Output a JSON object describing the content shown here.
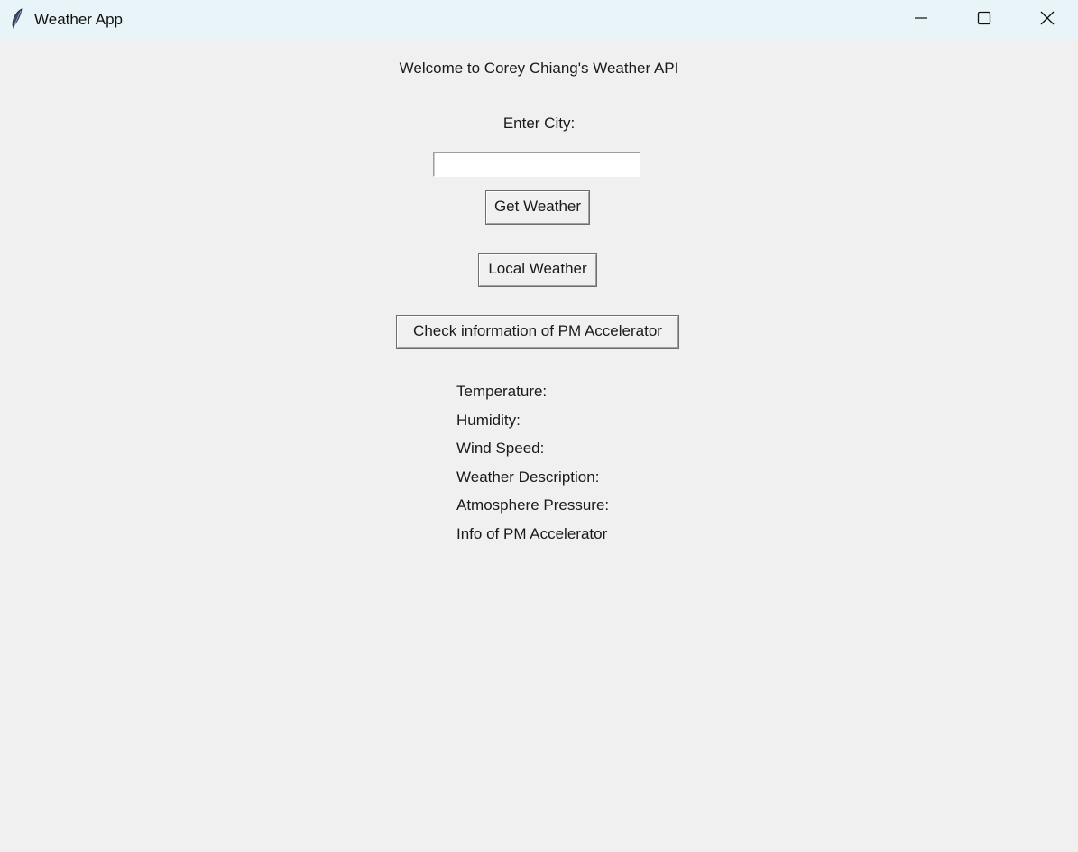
{
  "window": {
    "title": "Weather App",
    "icon": "feather-icon",
    "controls": {
      "minimize_icon": "minimize-icon",
      "maximize_icon": "maximize-icon",
      "close_icon": "close-icon"
    }
  },
  "main": {
    "welcome": "Welcome to Corey Chiang's Weather API",
    "city_label": "Enter City:",
    "city_input_value": "",
    "city_input_placeholder": "",
    "get_weather_label": "Get Weather",
    "local_weather_label": "Local Weather",
    "pm_info_label": "Check information of PM Accelerator"
  },
  "results": {
    "temperature": "Temperature:",
    "humidity": "Humidity:",
    "wind_speed": "Wind Speed:",
    "description": "Weather Description:",
    "pressure": "Atmosphere Pressure:",
    "pm_info": "Info of PM Accelerator"
  },
  "colors": {
    "background": "#f0f0f0",
    "titlebar": "#e8f4f8"
  }
}
